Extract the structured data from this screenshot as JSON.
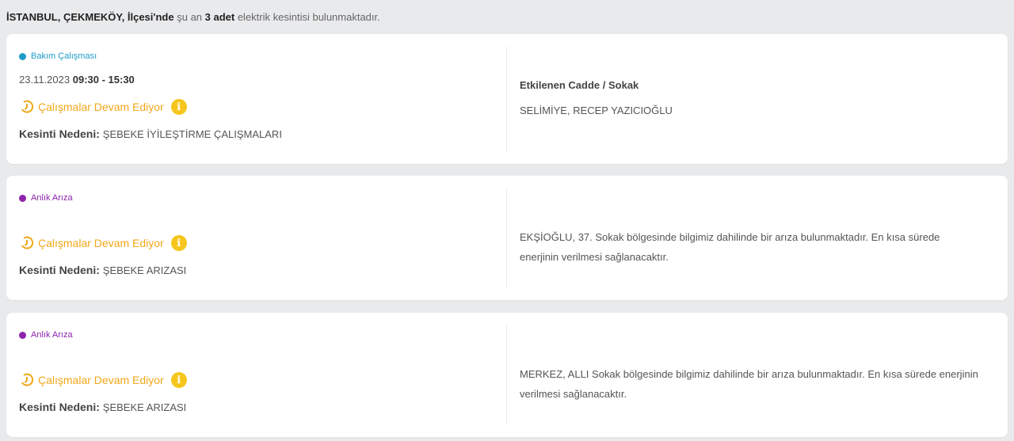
{
  "summary": {
    "location": "İSTANBUL, ÇEKMEKÖY, İlçesi'nde",
    "middle": " şu an ",
    "count": "3 adet",
    "tail": " elektrik kesintisi bulunmaktadır."
  },
  "colors": {
    "maintenance": "#1f9bc9",
    "fault": "#8e24aa",
    "status": "#f0a81b"
  },
  "cards": [
    {
      "type": "Bakım Çalışması",
      "date": "23.11.2023",
      "time": "09:30 - 15:30",
      "status": "Çalışmalar Devam Ediyor",
      "reason_label": "Kesinti Nedeni:",
      "reason_value": "ŞEBEKE İYİLEŞTİRME ÇALIŞMALARI",
      "affected_heading": "Etkilenen Cadde / Sokak",
      "affected_text": "SELİMİYE, RECEP YAZICIOĞLU"
    },
    {
      "type": "Anlık Arıza",
      "status": "Çalışmalar Devam Ediyor",
      "reason_label": "Kesinti Nedeni:",
      "reason_value": "ŞEBEKE ARIZASI",
      "affected_text": "EKŞİOĞLU, 37. Sokak bölgesinde bilgimiz dahilinde bir arıza bulunmaktadır. En kısa sürede enerjinin verilmesi sağlanacaktır."
    },
    {
      "type": "Anlık Arıza",
      "status": "Çalışmalar Devam Ediyor",
      "reason_label": "Kesinti Nedeni:",
      "reason_value": "ŞEBEKE ARIZASI",
      "affected_text": "MERKEZ, ALLI Sokak bölgesinde bilgimiz dahilinde bir arıza bulunmaktadır. En kısa sürede enerjinin verilmesi sağlanacaktır."
    }
  ]
}
